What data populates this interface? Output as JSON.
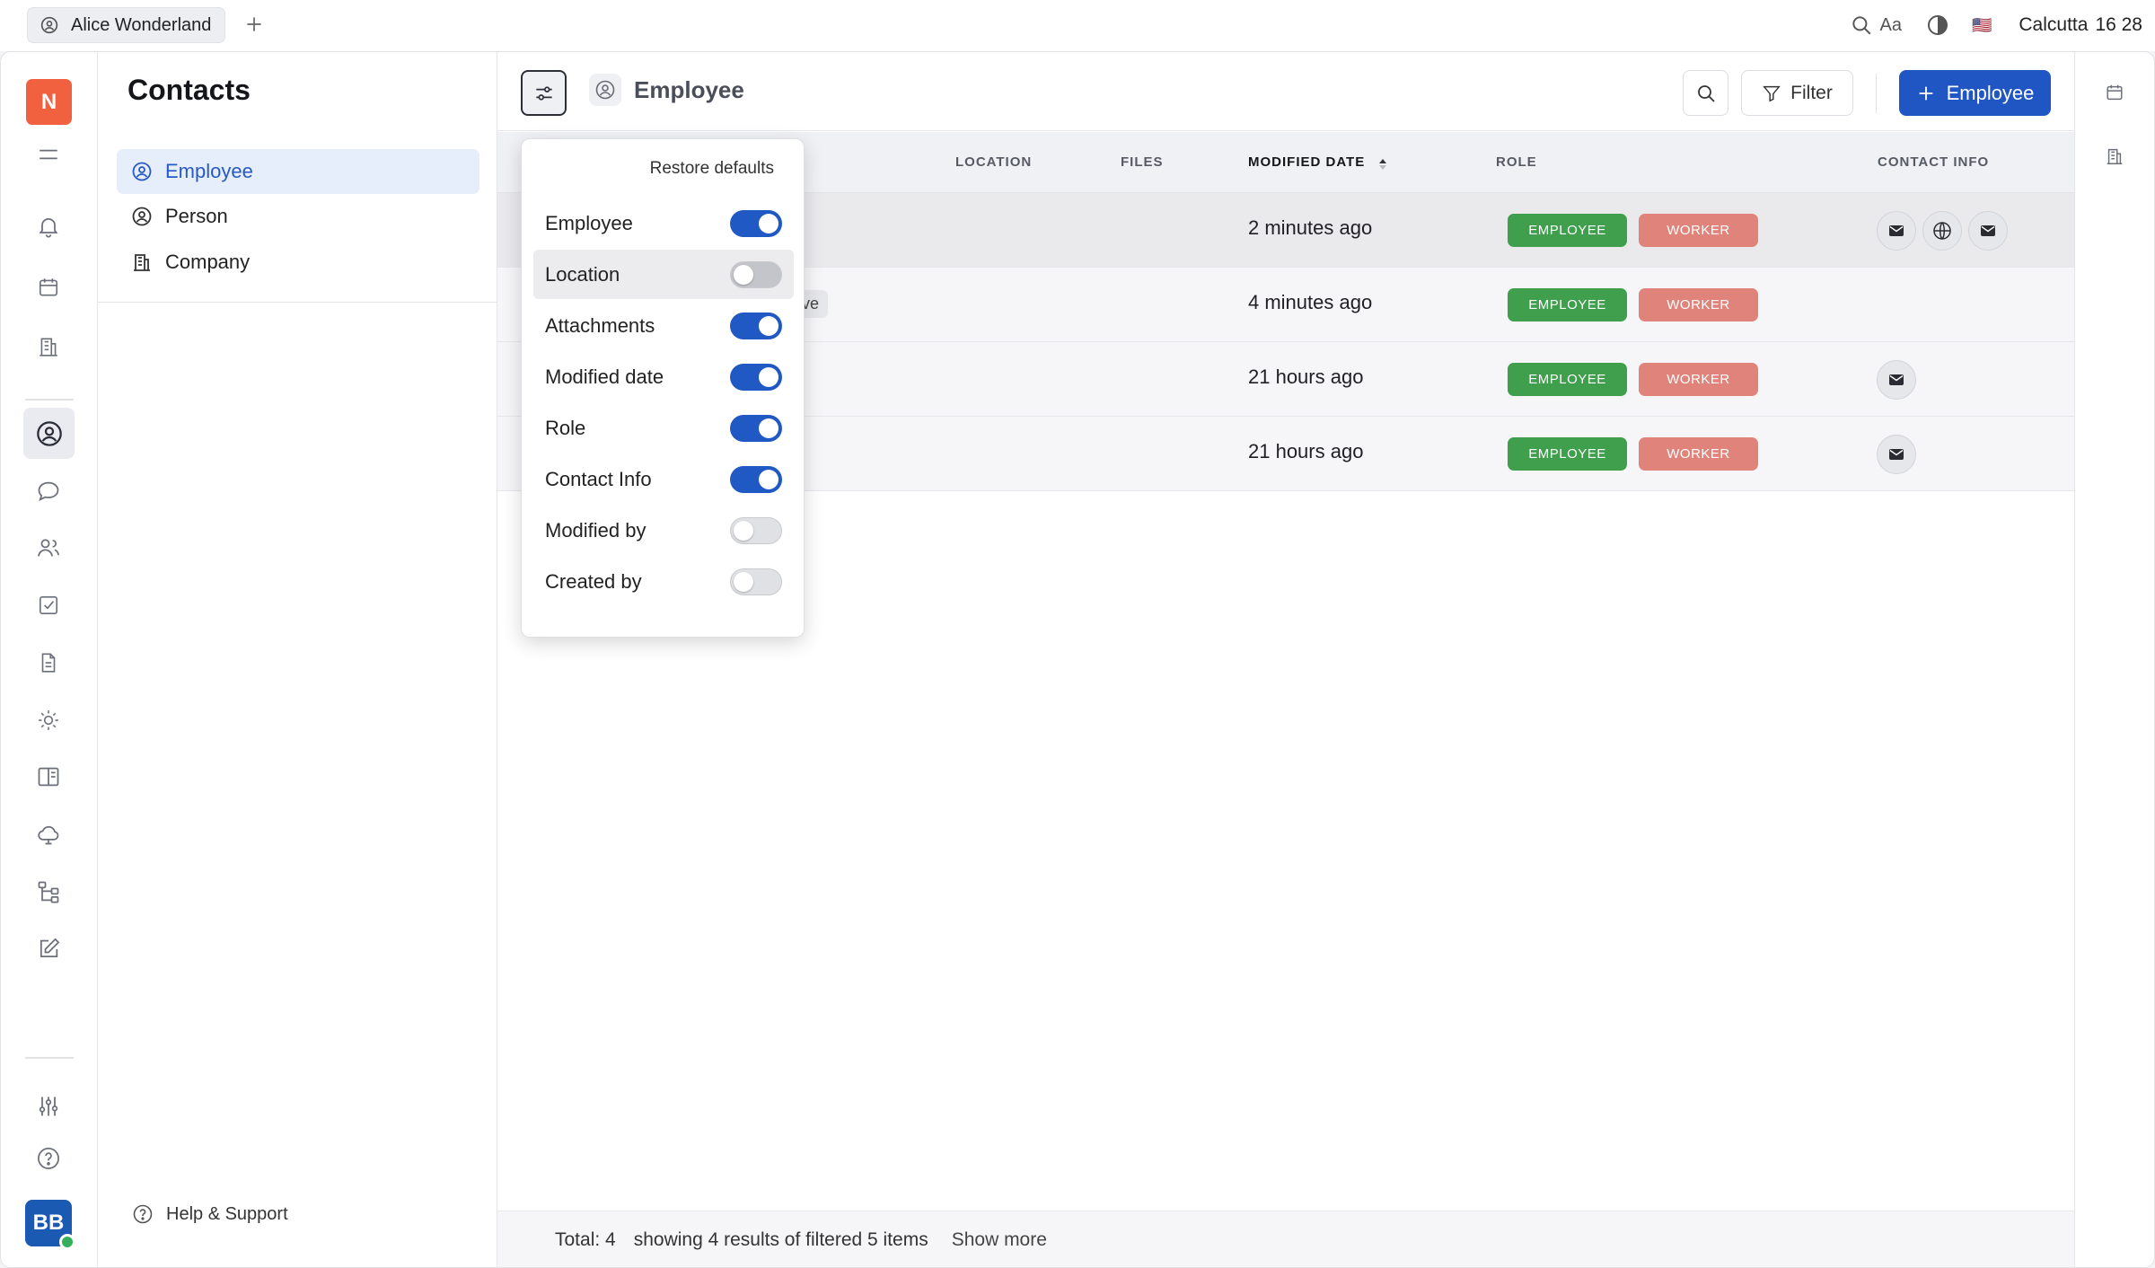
{
  "topbar": {
    "workspace_tab": "Alice Wonderland",
    "font_label": "Aa",
    "flag": "🇺🇸",
    "city": "Calcutta",
    "time": "16 28"
  },
  "rail": {
    "logo_letter": "N",
    "avatar_initials": "BB"
  },
  "navigator": {
    "title": "Contacts",
    "items": [
      {
        "label": "Employee",
        "icon": "person-circle-icon",
        "active": true
      },
      {
        "label": "Person",
        "icon": "person-circle-icon",
        "active": false
      },
      {
        "label": "Company",
        "icon": "building-icon",
        "active": false
      }
    ],
    "help_label": "Help & Support"
  },
  "header": {
    "title": "Employee",
    "filter_label": "Filter",
    "create_label": "Employee"
  },
  "table": {
    "columns": [
      "LOCATION",
      "FILES",
      "MODIFIED DATE",
      "ROLE",
      "CONTACT INFO"
    ],
    "rows": [
      {
        "modified": "2 minutes ago",
        "roles": [
          "EMPLOYEE",
          "WORKER"
        ],
        "contacts": [
          "mail-icon",
          "globe-icon",
          "mail-icon"
        ],
        "tag": ""
      },
      {
        "modified": "4 minutes ago",
        "roles": [
          "EMPLOYEE",
          "WORKER"
        ],
        "contacts": [],
        "tag": "tive"
      },
      {
        "modified": "21 hours ago",
        "roles": [
          "EMPLOYEE",
          "WORKER"
        ],
        "contacts": [
          "mail-icon"
        ],
        "tag": ""
      },
      {
        "modified": "21 hours ago",
        "roles": [
          "EMPLOYEE",
          "WORKER"
        ],
        "contacts": [
          "mail-icon"
        ],
        "tag": ""
      }
    ]
  },
  "footer": {
    "total": "Total: 4",
    "showing": "showing 4 results of filtered 5 items",
    "show_more": "Show more"
  },
  "popup": {
    "restore_label": "Restore defaults",
    "options": [
      {
        "label": "Employee",
        "on": true
      },
      {
        "label": "Location",
        "on": false
      },
      {
        "label": "Attachments",
        "on": true
      },
      {
        "label": "Modified date",
        "on": true
      },
      {
        "label": "Role",
        "on": true
      },
      {
        "label": "Contact Info",
        "on": true
      },
      {
        "label": "Modified by",
        "on": false
      },
      {
        "label": "Created by",
        "on": false
      }
    ]
  },
  "colors": {
    "accent": "#1f56c3",
    "employee_badge": "#3f9f4c",
    "worker_badge": "#e0847b",
    "logo": "#f2613f"
  }
}
